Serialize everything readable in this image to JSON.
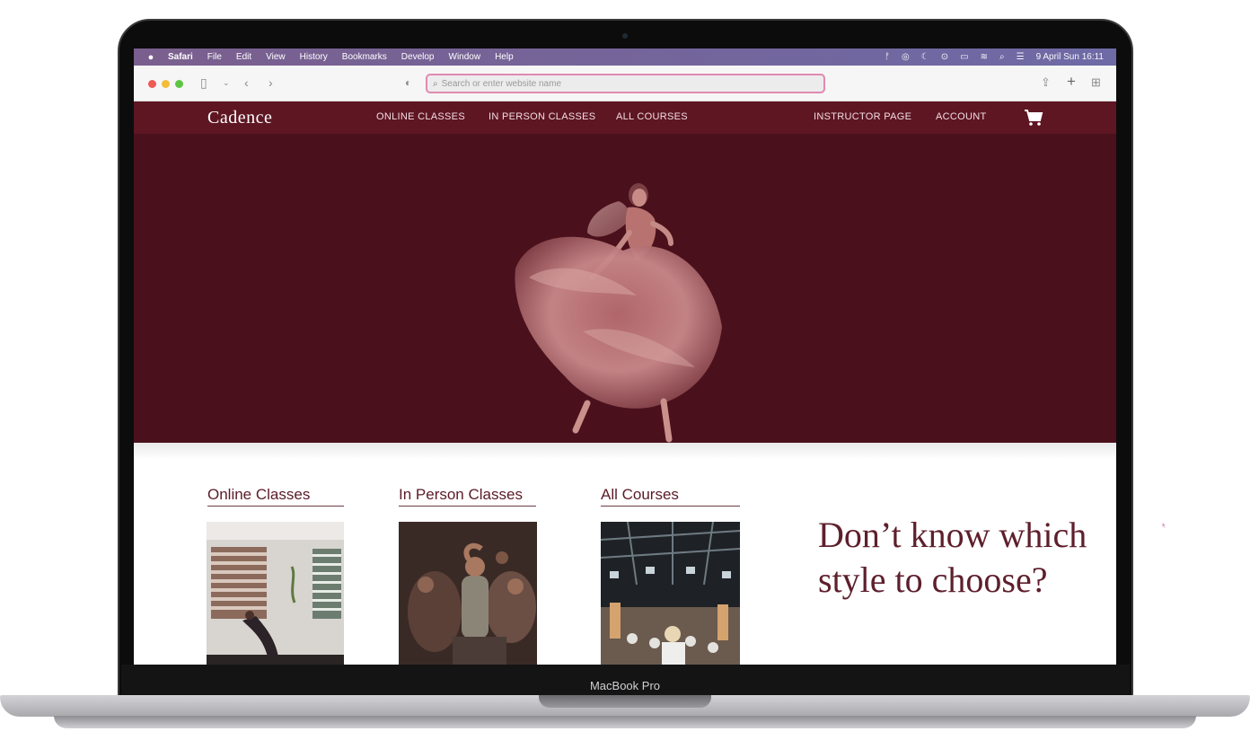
{
  "device": {
    "label": "MacBook Pro"
  },
  "menubar": {
    "app": "Safari",
    "items": [
      "File",
      "Edit",
      "View",
      "History",
      "Bookmarks",
      "Develop",
      "Window",
      "Help"
    ],
    "datetime": "9 April Sun  16:11",
    "status_icons": [
      "figma-icon",
      "creative-cloud-icon",
      "moon-icon",
      "play-icon",
      "battery-icon",
      "wifi-icon",
      "search-icon",
      "control-center-icon"
    ]
  },
  "browser": {
    "url_placeholder": "Search or enter website name"
  },
  "site": {
    "logo": "Cadence",
    "nav": {
      "online": "ONLINE CLASSES",
      "in_person": "IN PERSON CLASSES",
      "all_courses": "ALL COURSES",
      "instructor": "INSTRUCTOR PAGE",
      "account": "ACCOUNT"
    },
    "colors": {
      "brand": "#5e1622",
      "hero_bg": "#4a111c",
      "accent_text": "#5e1f2c"
    },
    "categories": [
      {
        "title": "Online Classes"
      },
      {
        "title": "In Person Classes"
      },
      {
        "title": "All Courses"
      }
    ],
    "headline": "Don’t know which style to choose?"
  }
}
